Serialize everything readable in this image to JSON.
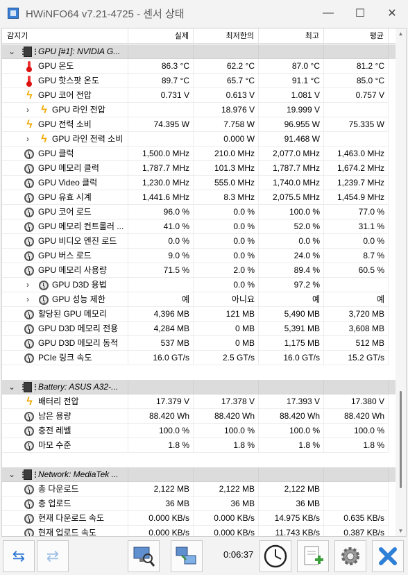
{
  "window": {
    "title": "HWiNFO64 v7.21-4725 - 센서 상태",
    "minimize_glyph": "—",
    "maximize_glyph": "☐",
    "close_glyph": "✕",
    "icon": "hwinfo-app-icon"
  },
  "columns": {
    "sensor": "감지기",
    "current": "실제",
    "min": "최저한의",
    "max": "최고",
    "avg": "평균"
  },
  "groups": {
    "gpu": {
      "label": "GPU [#1]: NVIDIA G...",
      "rows": [
        {
          "label": "GPU 온도",
          "icon": "thermometer-icon",
          "cur": "86.3 °C",
          "min": "62.2 °C",
          "max": "87.0 °C",
          "avg": "81.2 °C"
        },
        {
          "label": "GPU 핫스팟 온도",
          "icon": "thermometer-icon",
          "cur": "89.7 °C",
          "min": "65.7 °C",
          "max": "91.1 °C",
          "avg": "85.0 °C"
        },
        {
          "label": "GPU 코어 전압",
          "icon": "bolt-icon",
          "cur": "0.731 V",
          "min": "0.613 V",
          "max": "1.081 V",
          "avg": "0.757 V"
        },
        {
          "label": "GPU 라인 전압",
          "icon": "bolt-icon",
          "expandable": true,
          "cur": "",
          "min": "18.976 V",
          "max": "19.999 V",
          "avg": ""
        },
        {
          "label": "GPU 전력 소비",
          "icon": "bolt-icon",
          "cur": "74.395 W",
          "min": "7.758 W",
          "max": "96.955 W",
          "avg": "75.335 W"
        },
        {
          "label": "GPU 라인 전력 소비",
          "icon": "bolt-icon",
          "expandable": true,
          "cur": "",
          "min": "0.000 W",
          "max": "91.468 W",
          "avg": ""
        },
        {
          "label": "GPU 클럭",
          "icon": "clock-icon",
          "cur": "1,500.0 MHz",
          "min": "210.0 MHz",
          "max": "2,077.0 MHz",
          "avg": "1,463.0 MHz"
        },
        {
          "label": "GPU 메모리 클럭",
          "icon": "clock-icon",
          "cur": "1,787.7 MHz",
          "min": "101.3 MHz",
          "max": "1,787.7 MHz",
          "avg": "1,674.2 MHz"
        },
        {
          "label": "GPU Video 클럭",
          "icon": "clock-icon",
          "cur": "1,230.0 MHz",
          "min": "555.0 MHz",
          "max": "1,740.0 MHz",
          "avg": "1,239.7 MHz"
        },
        {
          "label": "GPU 유효 시계",
          "icon": "clock-icon",
          "cur": "1,441.6 MHz",
          "min": "8.3 MHz",
          "max": "2,075.5 MHz",
          "avg": "1,454.9 MHz"
        },
        {
          "label": "GPU 코어 로드",
          "icon": "clock-icon",
          "cur": "96.0 %",
          "min": "0.0 %",
          "max": "100.0 %",
          "avg": "77.0 %"
        },
        {
          "label": "GPU 메모리 컨트롤러 ...",
          "icon": "clock-icon",
          "cur": "41.0 %",
          "min": "0.0 %",
          "max": "52.0 %",
          "avg": "31.1 %"
        },
        {
          "label": "GPU 비디오 엔진 로드",
          "icon": "clock-icon",
          "cur": "0.0 %",
          "min": "0.0 %",
          "max": "0.0 %",
          "avg": "0.0 %"
        },
        {
          "label": "GPU 버스 로드",
          "icon": "clock-icon",
          "cur": "9.0 %",
          "min": "0.0 %",
          "max": "24.0 %",
          "avg": "8.7 %"
        },
        {
          "label": "GPU 메모리 사용량",
          "icon": "clock-icon",
          "cur": "71.5 %",
          "min": "2.0 %",
          "max": "89.4 %",
          "avg": "60.5 %"
        },
        {
          "label": "GPU D3D 용법",
          "icon": "clock-icon",
          "expandable": true,
          "cur": "",
          "min": "0.0 %",
          "max": "97.2 %",
          "avg": ""
        },
        {
          "label": "GPU 성능 제한",
          "icon": "clock-icon",
          "expandable": true,
          "cur": "예",
          "min": "아니요",
          "max": "예",
          "avg": "예"
        },
        {
          "label": "할당된 GPU 메모리",
          "icon": "clock-icon",
          "cur": "4,396 MB",
          "min": "121 MB",
          "max": "5,490 MB",
          "avg": "3,720 MB"
        },
        {
          "label": "GPU D3D 메모리 전용",
          "icon": "clock-icon",
          "cur": "4,284 MB",
          "min": "0 MB",
          "max": "5,391 MB",
          "avg": "3,608 MB"
        },
        {
          "label": "GPU D3D 메모리 동적",
          "icon": "clock-icon",
          "cur": "537 MB",
          "min": "0 MB",
          "max": "1,175 MB",
          "avg": "512 MB"
        },
        {
          "label": "PCIe 링크 속도",
          "icon": "clock-icon",
          "cur": "16.0 GT/s",
          "min": "2.5 GT/s",
          "max": "16.0 GT/s",
          "avg": "15.2 GT/s"
        }
      ]
    },
    "battery": {
      "label": "Battery: ASUS  A32-...",
      "rows": [
        {
          "label": "배터리 전압",
          "icon": "bolt-icon",
          "cur": "17.379 V",
          "min": "17.378 V",
          "max": "17.393 V",
          "avg": "17.380 V"
        },
        {
          "label": "남은 용량",
          "icon": "clock-icon",
          "cur": "88.420 Wh",
          "min": "88.420 Wh",
          "max": "88.420 Wh",
          "avg": "88.420 Wh"
        },
        {
          "label": "충전 레벨",
          "icon": "clock-icon",
          "cur": "100.0 %",
          "min": "100.0 %",
          "max": "100.0 %",
          "avg": "100.0 %"
        },
        {
          "label": "마모 수준",
          "icon": "clock-icon",
          "cur": "1.8 %",
          "min": "1.8 %",
          "max": "1.8 %",
          "avg": "1.8 %"
        }
      ]
    },
    "network": {
      "label": "Network: MediaTek ...",
      "rows": [
        {
          "label": "총 다운로드",
          "icon": "clock-icon",
          "cur": "2,122 MB",
          "min": "2,122 MB",
          "max": "2,122 MB",
          "avg": ""
        },
        {
          "label": "총 업로드",
          "icon": "clock-icon",
          "cur": "36 MB",
          "min": "36 MB",
          "max": "36 MB",
          "avg": ""
        },
        {
          "label": "현재 다운로드 속도",
          "icon": "clock-icon",
          "cur": "0.000 KB/s",
          "min": "0.000 KB/s",
          "max": "14.975 KB/s",
          "avg": "0.635 KB/s"
        },
        {
          "label": "현재 업로드 속도",
          "icon": "clock-icon",
          "cur": "0.000 KB/s",
          "min": "0.000 KB/s",
          "max": "11.743 KB/s",
          "avg": "0.387 KB/s"
        }
      ]
    }
  },
  "toolbar": {
    "elapsed": "0:06:37"
  }
}
